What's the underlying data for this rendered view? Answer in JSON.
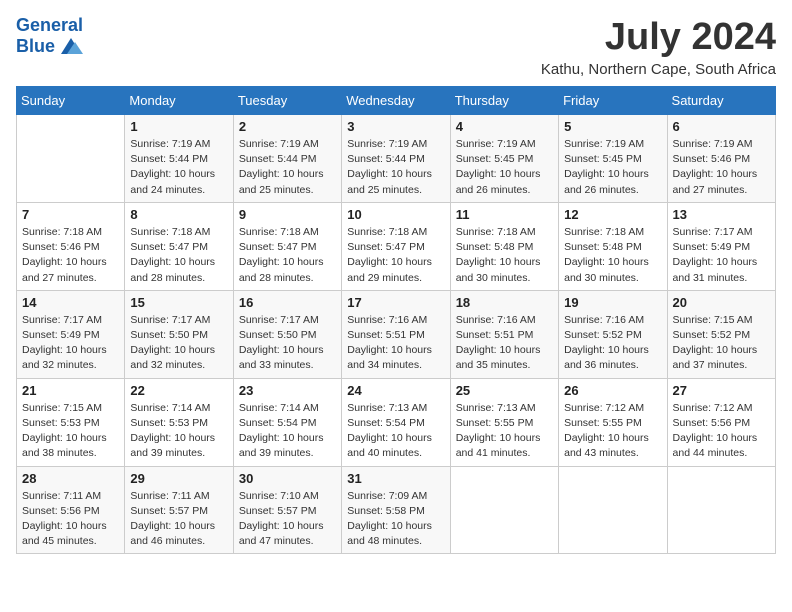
{
  "header": {
    "logo_line1": "General",
    "logo_line2": "Blue",
    "month_title": "July 2024",
    "location": "Kathu, Northern Cape, South Africa"
  },
  "days_of_week": [
    "Sunday",
    "Monday",
    "Tuesday",
    "Wednesday",
    "Thursday",
    "Friday",
    "Saturday"
  ],
  "weeks": [
    [
      {
        "num": "",
        "sunrise": "",
        "sunset": "",
        "daylight": ""
      },
      {
        "num": "1",
        "sunrise": "Sunrise: 7:19 AM",
        "sunset": "Sunset: 5:44 PM",
        "daylight": "Daylight: 10 hours and 24 minutes."
      },
      {
        "num": "2",
        "sunrise": "Sunrise: 7:19 AM",
        "sunset": "Sunset: 5:44 PM",
        "daylight": "Daylight: 10 hours and 25 minutes."
      },
      {
        "num": "3",
        "sunrise": "Sunrise: 7:19 AM",
        "sunset": "Sunset: 5:44 PM",
        "daylight": "Daylight: 10 hours and 25 minutes."
      },
      {
        "num": "4",
        "sunrise": "Sunrise: 7:19 AM",
        "sunset": "Sunset: 5:45 PM",
        "daylight": "Daylight: 10 hours and 26 minutes."
      },
      {
        "num": "5",
        "sunrise": "Sunrise: 7:19 AM",
        "sunset": "Sunset: 5:45 PM",
        "daylight": "Daylight: 10 hours and 26 minutes."
      },
      {
        "num": "6",
        "sunrise": "Sunrise: 7:19 AM",
        "sunset": "Sunset: 5:46 PM",
        "daylight": "Daylight: 10 hours and 27 minutes."
      }
    ],
    [
      {
        "num": "7",
        "sunrise": "Sunrise: 7:18 AM",
        "sunset": "Sunset: 5:46 PM",
        "daylight": "Daylight: 10 hours and 27 minutes."
      },
      {
        "num": "8",
        "sunrise": "Sunrise: 7:18 AM",
        "sunset": "Sunset: 5:47 PM",
        "daylight": "Daylight: 10 hours and 28 minutes."
      },
      {
        "num": "9",
        "sunrise": "Sunrise: 7:18 AM",
        "sunset": "Sunset: 5:47 PM",
        "daylight": "Daylight: 10 hours and 28 minutes."
      },
      {
        "num": "10",
        "sunrise": "Sunrise: 7:18 AM",
        "sunset": "Sunset: 5:47 PM",
        "daylight": "Daylight: 10 hours and 29 minutes."
      },
      {
        "num": "11",
        "sunrise": "Sunrise: 7:18 AM",
        "sunset": "Sunset: 5:48 PM",
        "daylight": "Daylight: 10 hours and 30 minutes."
      },
      {
        "num": "12",
        "sunrise": "Sunrise: 7:18 AM",
        "sunset": "Sunset: 5:48 PM",
        "daylight": "Daylight: 10 hours and 30 minutes."
      },
      {
        "num": "13",
        "sunrise": "Sunrise: 7:17 AM",
        "sunset": "Sunset: 5:49 PM",
        "daylight": "Daylight: 10 hours and 31 minutes."
      }
    ],
    [
      {
        "num": "14",
        "sunrise": "Sunrise: 7:17 AM",
        "sunset": "Sunset: 5:49 PM",
        "daylight": "Daylight: 10 hours and 32 minutes."
      },
      {
        "num": "15",
        "sunrise": "Sunrise: 7:17 AM",
        "sunset": "Sunset: 5:50 PM",
        "daylight": "Daylight: 10 hours and 32 minutes."
      },
      {
        "num": "16",
        "sunrise": "Sunrise: 7:17 AM",
        "sunset": "Sunset: 5:50 PM",
        "daylight": "Daylight: 10 hours and 33 minutes."
      },
      {
        "num": "17",
        "sunrise": "Sunrise: 7:16 AM",
        "sunset": "Sunset: 5:51 PM",
        "daylight": "Daylight: 10 hours and 34 minutes."
      },
      {
        "num": "18",
        "sunrise": "Sunrise: 7:16 AM",
        "sunset": "Sunset: 5:51 PM",
        "daylight": "Daylight: 10 hours and 35 minutes."
      },
      {
        "num": "19",
        "sunrise": "Sunrise: 7:16 AM",
        "sunset": "Sunset: 5:52 PM",
        "daylight": "Daylight: 10 hours and 36 minutes."
      },
      {
        "num": "20",
        "sunrise": "Sunrise: 7:15 AM",
        "sunset": "Sunset: 5:52 PM",
        "daylight": "Daylight: 10 hours and 37 minutes."
      }
    ],
    [
      {
        "num": "21",
        "sunrise": "Sunrise: 7:15 AM",
        "sunset": "Sunset: 5:53 PM",
        "daylight": "Daylight: 10 hours and 38 minutes."
      },
      {
        "num": "22",
        "sunrise": "Sunrise: 7:14 AM",
        "sunset": "Sunset: 5:53 PM",
        "daylight": "Daylight: 10 hours and 39 minutes."
      },
      {
        "num": "23",
        "sunrise": "Sunrise: 7:14 AM",
        "sunset": "Sunset: 5:54 PM",
        "daylight": "Daylight: 10 hours and 39 minutes."
      },
      {
        "num": "24",
        "sunrise": "Sunrise: 7:13 AM",
        "sunset": "Sunset: 5:54 PM",
        "daylight": "Daylight: 10 hours and 40 minutes."
      },
      {
        "num": "25",
        "sunrise": "Sunrise: 7:13 AM",
        "sunset": "Sunset: 5:55 PM",
        "daylight": "Daylight: 10 hours and 41 minutes."
      },
      {
        "num": "26",
        "sunrise": "Sunrise: 7:12 AM",
        "sunset": "Sunset: 5:55 PM",
        "daylight": "Daylight: 10 hours and 43 minutes."
      },
      {
        "num": "27",
        "sunrise": "Sunrise: 7:12 AM",
        "sunset": "Sunset: 5:56 PM",
        "daylight": "Daylight: 10 hours and 44 minutes."
      }
    ],
    [
      {
        "num": "28",
        "sunrise": "Sunrise: 7:11 AM",
        "sunset": "Sunset: 5:56 PM",
        "daylight": "Daylight: 10 hours and 45 minutes."
      },
      {
        "num": "29",
        "sunrise": "Sunrise: 7:11 AM",
        "sunset": "Sunset: 5:57 PM",
        "daylight": "Daylight: 10 hours and 46 minutes."
      },
      {
        "num": "30",
        "sunrise": "Sunrise: 7:10 AM",
        "sunset": "Sunset: 5:57 PM",
        "daylight": "Daylight: 10 hours and 47 minutes."
      },
      {
        "num": "31",
        "sunrise": "Sunrise: 7:09 AM",
        "sunset": "Sunset: 5:58 PM",
        "daylight": "Daylight: 10 hours and 48 minutes."
      },
      {
        "num": "",
        "sunrise": "",
        "sunset": "",
        "daylight": ""
      },
      {
        "num": "",
        "sunrise": "",
        "sunset": "",
        "daylight": ""
      },
      {
        "num": "",
        "sunrise": "",
        "sunset": "",
        "daylight": ""
      }
    ]
  ]
}
